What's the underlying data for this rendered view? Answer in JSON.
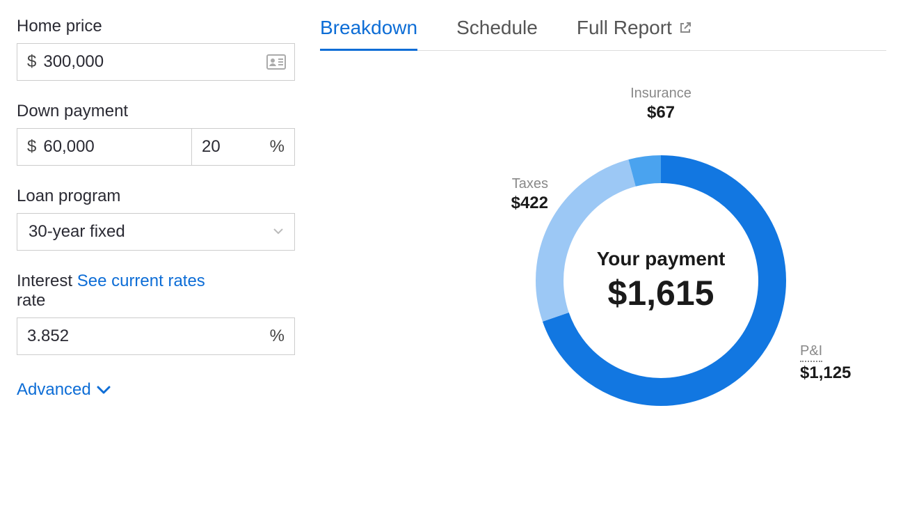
{
  "form": {
    "home_price": {
      "label": "Home price",
      "prefix": "$",
      "value": "300,000"
    },
    "down_payment": {
      "label": "Down payment",
      "prefix": "$",
      "value": "60,000",
      "percent_value": "20",
      "percent_suffix": "%"
    },
    "loan_program": {
      "label": "Loan program",
      "value": "30-year fixed"
    },
    "interest": {
      "label_part1": "Interest",
      "link": "See current rates",
      "label_part2": "rate",
      "value": "3.852",
      "suffix": "%"
    },
    "advanced_label": "Advanced"
  },
  "tabs": {
    "breakdown": "Breakdown",
    "schedule": "Schedule",
    "full_report": "Full Report"
  },
  "chart": {
    "center_label": "Your payment",
    "center_value": "$1,615",
    "segments": {
      "insurance": {
        "name": "Insurance",
        "value": "$67"
      },
      "taxes": {
        "name": "Taxes",
        "value": "$422"
      },
      "pi": {
        "name": "P&I",
        "value": "$1,125"
      }
    }
  },
  "colors": {
    "accent": "#0d6dd6",
    "donut_pi": "#1277e1",
    "donut_taxes": "#9cc8f5",
    "donut_insurance": "#4aa3ef"
  },
  "chart_data": {
    "type": "pie",
    "title": "Your payment",
    "total": 1615,
    "series": [
      {
        "name": "P&I",
        "value": 1125
      },
      {
        "name": "Taxes",
        "value": 422
      },
      {
        "name": "Insurance",
        "value": 67
      }
    ]
  }
}
